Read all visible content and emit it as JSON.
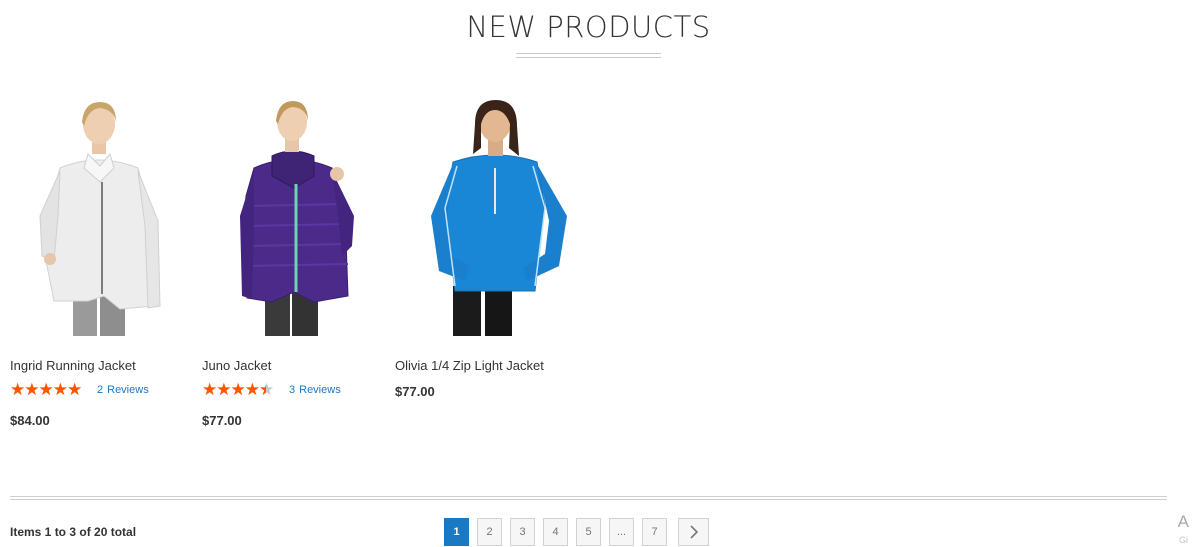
{
  "section": {
    "title": "NEW PRODUCTS"
  },
  "products": [
    {
      "name": "Ingrid Running Jacket",
      "rating": 0.9,
      "review_count": "2",
      "reviews_label": "Reviews",
      "price": "$84.00",
      "jacket_color": "#ededed"
    },
    {
      "name": "Juno Jacket",
      "rating": 0.8,
      "review_count": "3",
      "reviews_label": "Reviews",
      "price": "$77.00",
      "jacket_color": "#4b2a8a"
    },
    {
      "name": "Olivia 1/4 Zip Light Jacket",
      "price": "$77.00",
      "jacket_color": "#1a86d6"
    }
  ],
  "toolbar": {
    "items_text": "Items 1 to 3 of 20 total",
    "pages": [
      "1",
      "2",
      "3",
      "4",
      "5",
      "...",
      "7"
    ],
    "current_page": "1",
    "next_icon": "chevron-right-icon"
  },
  "corner": {
    "letter": "A",
    "sub": "Gi"
  },
  "colors": {
    "accent": "#1979c3",
    "star": "#ff5501",
    "text": "#333333"
  }
}
